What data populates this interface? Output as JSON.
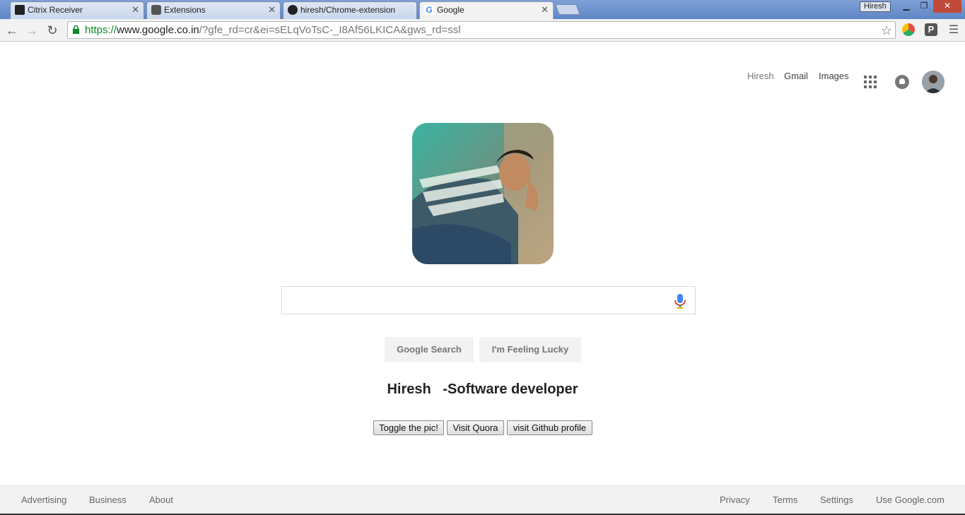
{
  "browser": {
    "tabs": [
      {
        "label": "Citrix Receiver",
        "active": false
      },
      {
        "label": "Extensions",
        "active": false
      },
      {
        "label": "hiresh/Chrome-extension",
        "active": false
      },
      {
        "label": "Google",
        "active": true
      }
    ],
    "profile_name": "Hiresh",
    "window_controls": {
      "minimize": "▁",
      "restore": "❐",
      "close": "✕"
    },
    "url": {
      "scheme": "https://",
      "host": "www.google.co.in",
      "rest": "/?gfe_rd=cr&ei=sELqVoTsC-_I8Af56LKICA&gws_rd=ssl"
    }
  },
  "header": {
    "user": "Hiresh",
    "gmail": "Gmail",
    "images": "Images"
  },
  "search": {
    "value": "",
    "buttons": {
      "search": "Google Search",
      "lucky": "I'm Feeling Lucky"
    }
  },
  "tagline": "Hiresh   -Software developer",
  "extension_buttons": {
    "toggle": "Toggle the pic!",
    "quora": "Visit Quora",
    "github": "visit Github profile"
  },
  "footer": {
    "left": [
      "Advertising",
      "Business",
      "About"
    ],
    "right": [
      "Privacy",
      "Terms",
      "Settings",
      "Use Google.com"
    ]
  },
  "colors": {
    "tab_strip": "#6b8ec9",
    "secure_url": "#0a8a2a",
    "footer_bg": "#f2f2f2"
  }
}
